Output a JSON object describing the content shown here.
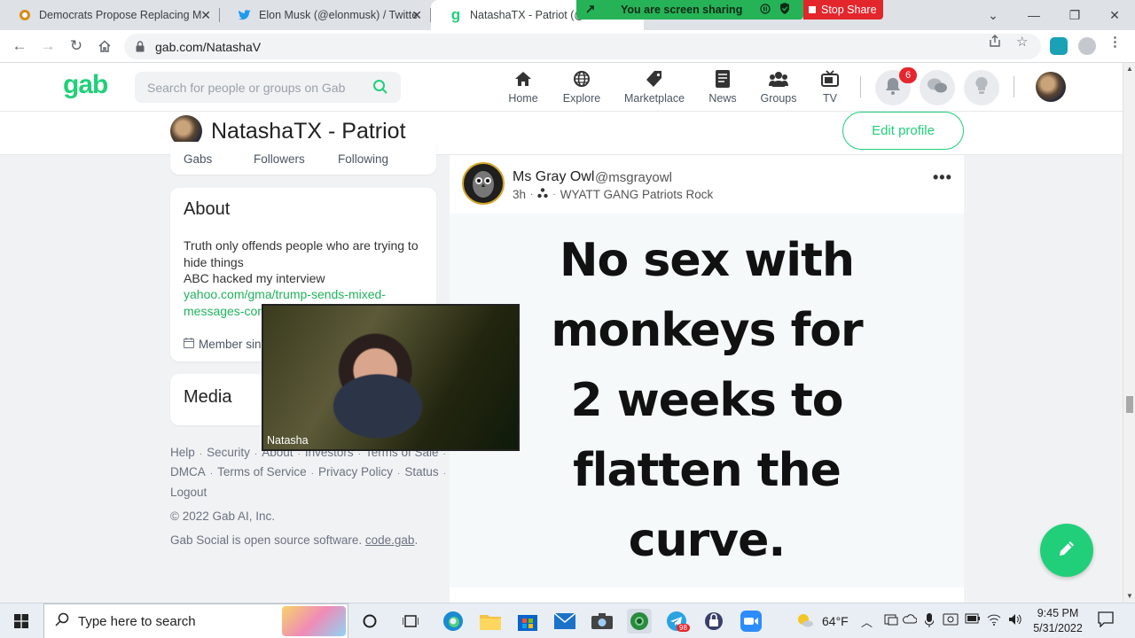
{
  "browser": {
    "tabs": [
      {
        "title": "Democrats Propose Replacing M",
        "active": false
      },
      {
        "title": "Elon Musk (@elonmusk) / Twitter",
        "active": false
      },
      {
        "title": "NatashaTX - Patriot (@N",
        "active": true
      }
    ],
    "url": "gab.com/NatashaV",
    "screen_share_label": "You are screen sharing",
    "stop_share_label": "Stop Share"
  },
  "gab": {
    "logo": "gab",
    "search_placeholder": "Search for people or groups on Gab",
    "nav": [
      {
        "label": "Home",
        "icon": "home-icon"
      },
      {
        "label": "Explore",
        "icon": "globe-icon"
      },
      {
        "label": "Marketplace",
        "icon": "tag-icon"
      },
      {
        "label": "News",
        "icon": "newspaper-icon"
      },
      {
        "label": "Groups",
        "icon": "groups-icon"
      },
      {
        "label": "TV",
        "icon": "tv-icon"
      }
    ],
    "notification_count": "6",
    "accent": "#21cf7a"
  },
  "profile": {
    "name": "NatashaTX - Patriot",
    "edit_label": "Edit profile",
    "stats": {
      "gabs": "Gabs",
      "followers": "Followers",
      "following": "Following"
    },
    "about": {
      "title": "About",
      "line1": "Truth only offends people who are trying to",
      "line2": "hide things",
      "line3": "ABC hacked my interview",
      "link1": "yahoo.com/gma/trump-sends-mixed-",
      "link2": "messages-coro",
      "member": "Member sinc"
    },
    "media_title": "Media"
  },
  "footer": {
    "links_row1": [
      "Help",
      "Security",
      "About",
      "Investors",
      "Terms of Sale"
    ],
    "links_row2": [
      "DMCA",
      "Terms of Service",
      "Privacy Policy",
      "Status"
    ],
    "logout": "Logout",
    "copyright": "© 2022 Gab AI, Inc.",
    "oss_text": "Gab Social is open source software.",
    "oss_link": "code.gab"
  },
  "post": {
    "author": "Ms Gray Owl",
    "handle": "@msgrayowl",
    "time": "3h",
    "group": "WYATT GANG Patriots Rock",
    "image_text": [
      "No sex with",
      "monkeys for",
      "2 weeks to",
      "flatten the",
      "curve."
    ]
  },
  "webcam": {
    "name": "Natasha"
  },
  "taskbar": {
    "search_placeholder": "Type here to search",
    "weather": "64°F",
    "time": "9:45 PM",
    "date": "5/31/2022",
    "telegram_badge": "98"
  }
}
